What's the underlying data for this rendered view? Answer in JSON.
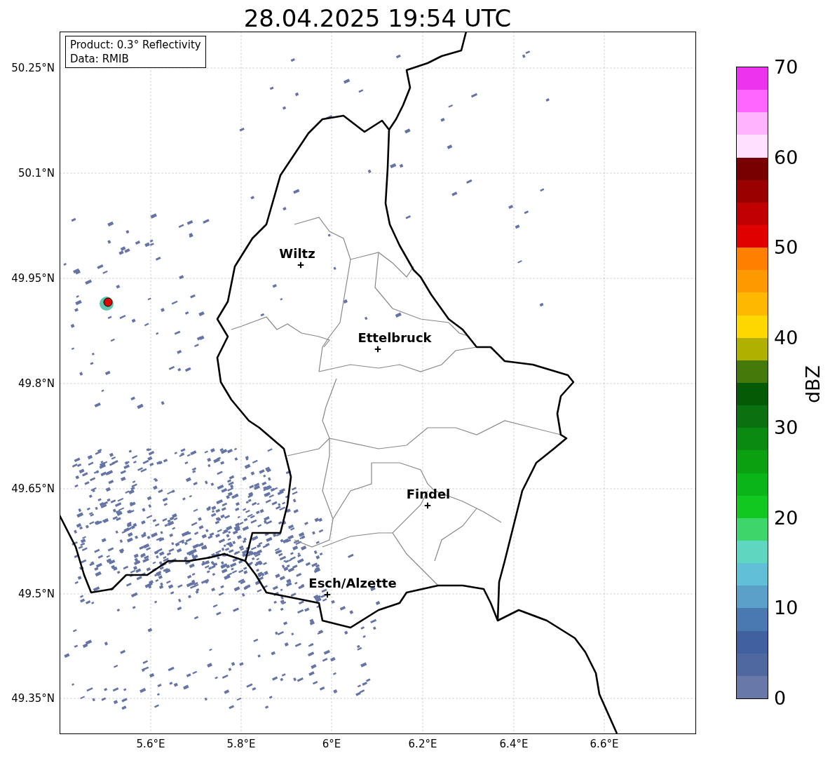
{
  "title": "28.04.2025 19:54 UTC",
  "info_box": [
    "Product: 0.3° Reflectivity",
    "Data: RMIB"
  ],
  "cities": [
    {
      "name": "Wiltz"
    },
    {
      "name": "Ettelbruck"
    },
    {
      "name": "Findel"
    },
    {
      "name": "Esch/Alzette"
    }
  ],
  "lat_ticks": [
    "50.25°N",
    "50.1°N",
    "49.95°N",
    "49.8°N",
    "49.65°N",
    "49.5°N",
    "49.35°N"
  ],
  "lon_ticks": [
    "5.6°E",
    "5.8°E",
    "6°E",
    "6.2°E",
    "6.4°E",
    "6.6°E"
  ],
  "colorbar": {
    "label": "dBZ",
    "ticks": [
      "70",
      "60",
      "50",
      "40",
      "30",
      "20",
      "10",
      "0"
    ],
    "bands": [
      {
        "color": "#ee33ee"
      },
      {
        "color": "#ff66ff"
      },
      {
        "color": "#ffb3ff"
      },
      {
        "color": "#ffe0ff"
      },
      {
        "color": "#780000"
      },
      {
        "color": "#9a0000"
      },
      {
        "color": "#c00000"
      },
      {
        "color": "#e00000"
      },
      {
        "color": "#ff7f00"
      },
      {
        "color": "#ff9900"
      },
      {
        "color": "#ffb800"
      },
      {
        "color": "#ffd700"
      },
      {
        "color": "#b0b000"
      },
      {
        "color": "#457a0a"
      },
      {
        "color": "#055a05"
      },
      {
        "color": "#0a7010"
      },
      {
        "color": "#0a8a10"
      },
      {
        "color": "#0aa010"
      },
      {
        "color": "#0ab518"
      },
      {
        "color": "#10c820"
      },
      {
        "color": "#3cd66a"
      },
      {
        "color": "#5ed6c0"
      },
      {
        "color": "#60c0d8"
      },
      {
        "color": "#5aa0c8"
      },
      {
        "color": "#4a78b0"
      },
      {
        "color": "#4060a0"
      },
      {
        "color": "#5068a0"
      },
      {
        "color": "#6878a8"
      }
    ]
  }
}
